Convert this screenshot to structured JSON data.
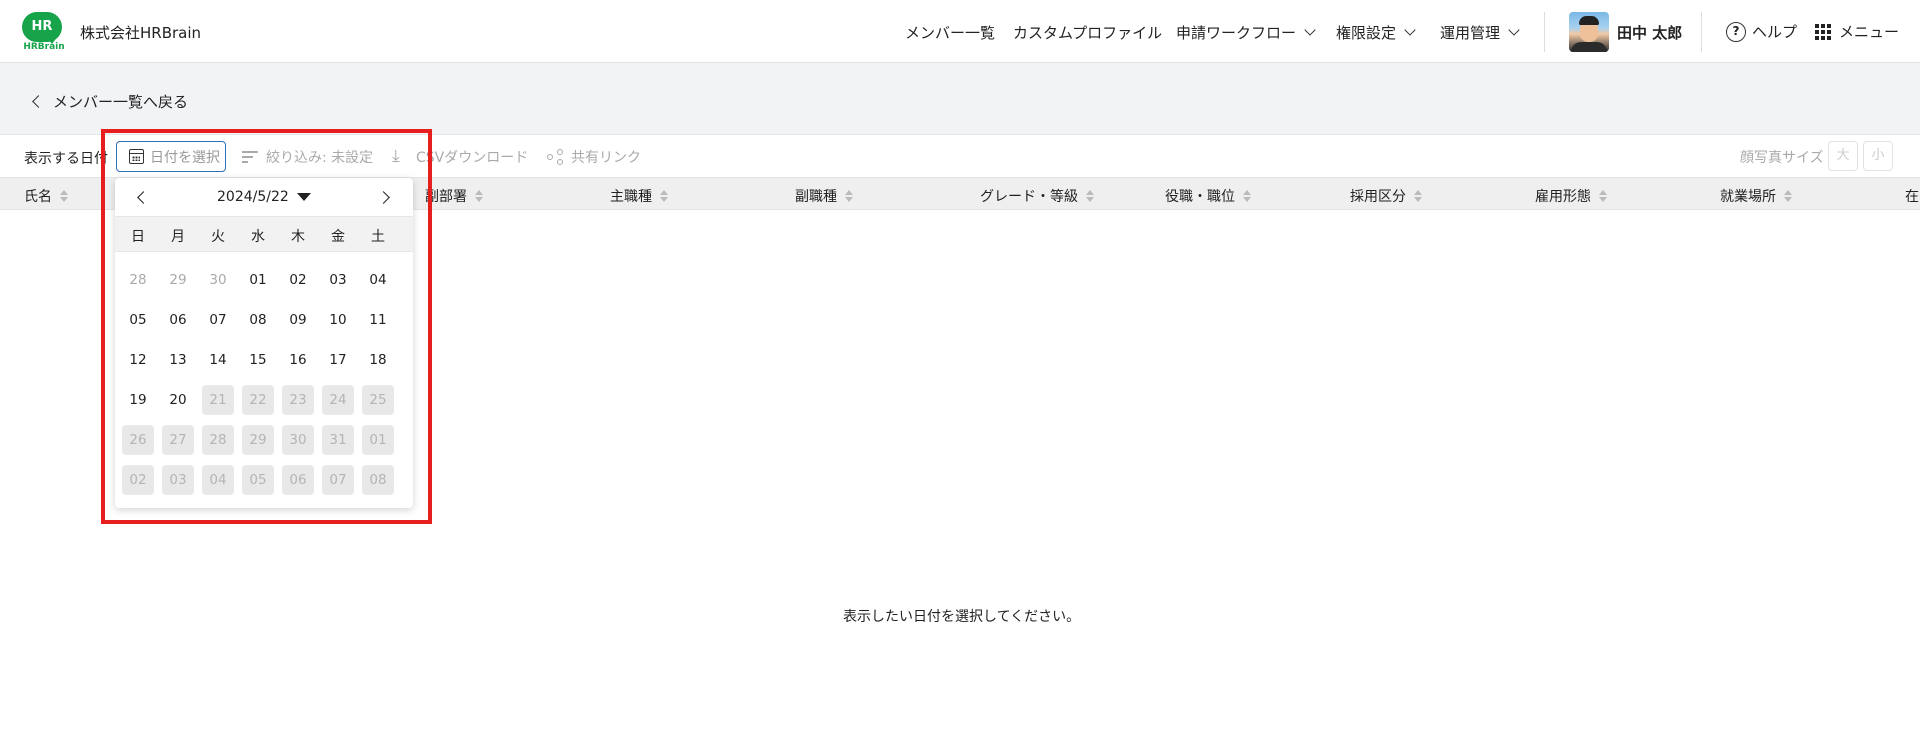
{
  "header": {
    "logo_text": "HR",
    "logo_word": "HRBrain",
    "company": "株式会社HRBrain",
    "nav": [
      {
        "label": "メンバー一覧",
        "has_dropdown": false
      },
      {
        "label": "カスタムプロファイル",
        "has_dropdown": false
      },
      {
        "label": "申請ワークフロー",
        "has_dropdown": true
      },
      {
        "label": "権限設定",
        "has_dropdown": true
      },
      {
        "label": "運用管理",
        "has_dropdown": true
      }
    ],
    "user_name": "田中 太郎",
    "help_icon_glyph": "?",
    "help_label": "ヘルプ",
    "menu_label": "メニュー"
  },
  "back_link": "メンバー一覧へ戻る",
  "toolbar": {
    "date_label": "表示する日付",
    "date_button": "日付を選択",
    "filter": "絞り込み: 未設定",
    "csv": "CSVダウンロード",
    "share": "共有リンク",
    "photo_size_label": "顔写真サイズ",
    "size_large": "大",
    "size_small": "小"
  },
  "table": {
    "columns": [
      "氏名",
      "副部署",
      "主職種",
      "副職種",
      "グレード・等級",
      "役職・職位",
      "採用区分",
      "雇用形態",
      "就業場所",
      "在"
    ],
    "empty_message": "表示したい日付を選択してください。"
  },
  "datepicker": {
    "title": "2024/5/22",
    "weekdays": [
      "日",
      "月",
      "火",
      "水",
      "木",
      "金",
      "土"
    ],
    "weeks": [
      [
        {
          "d": "28",
          "s": "muted"
        },
        {
          "d": "29",
          "s": "muted"
        },
        {
          "d": "30",
          "s": "muted"
        },
        {
          "d": "01",
          "s": "normal"
        },
        {
          "d": "02",
          "s": "normal"
        },
        {
          "d": "03",
          "s": "normal"
        },
        {
          "d": "04",
          "s": "normal"
        }
      ],
      [
        {
          "d": "05",
          "s": "normal"
        },
        {
          "d": "06",
          "s": "normal"
        },
        {
          "d": "07",
          "s": "normal"
        },
        {
          "d": "08",
          "s": "normal"
        },
        {
          "d": "09",
          "s": "normal"
        },
        {
          "d": "10",
          "s": "normal"
        },
        {
          "d": "11",
          "s": "normal"
        }
      ],
      [
        {
          "d": "12",
          "s": "normal"
        },
        {
          "d": "13",
          "s": "normal"
        },
        {
          "d": "14",
          "s": "normal"
        },
        {
          "d": "15",
          "s": "normal"
        },
        {
          "d": "16",
          "s": "normal"
        },
        {
          "d": "17",
          "s": "normal"
        },
        {
          "d": "18",
          "s": "normal"
        }
      ],
      [
        {
          "d": "19",
          "s": "normal"
        },
        {
          "d": "20",
          "s": "normal"
        },
        {
          "d": "21",
          "s": "disabled"
        },
        {
          "d": "22",
          "s": "disabled"
        },
        {
          "d": "23",
          "s": "disabled"
        },
        {
          "d": "24",
          "s": "disabled"
        },
        {
          "d": "25",
          "s": "disabled"
        }
      ],
      [
        {
          "d": "26",
          "s": "disabled"
        },
        {
          "d": "27",
          "s": "disabled"
        },
        {
          "d": "28",
          "s": "disabled"
        },
        {
          "d": "29",
          "s": "disabled"
        },
        {
          "d": "30",
          "s": "disabled"
        },
        {
          "d": "31",
          "s": "disabled"
        },
        {
          "d": "01",
          "s": "disabled"
        }
      ],
      [
        {
          "d": "02",
          "s": "disabled"
        },
        {
          "d": "03",
          "s": "disabled"
        },
        {
          "d": "04",
          "s": "disabled"
        },
        {
          "d": "05",
          "s": "disabled"
        },
        {
          "d": "06",
          "s": "disabled"
        },
        {
          "d": "07",
          "s": "disabled"
        },
        {
          "d": "08",
          "s": "disabled"
        }
      ]
    ]
  },
  "colors": {
    "brand_green": "#16a34a",
    "highlight_red": "#e61e1e",
    "focus_blue": "#2f6fb8"
  }
}
